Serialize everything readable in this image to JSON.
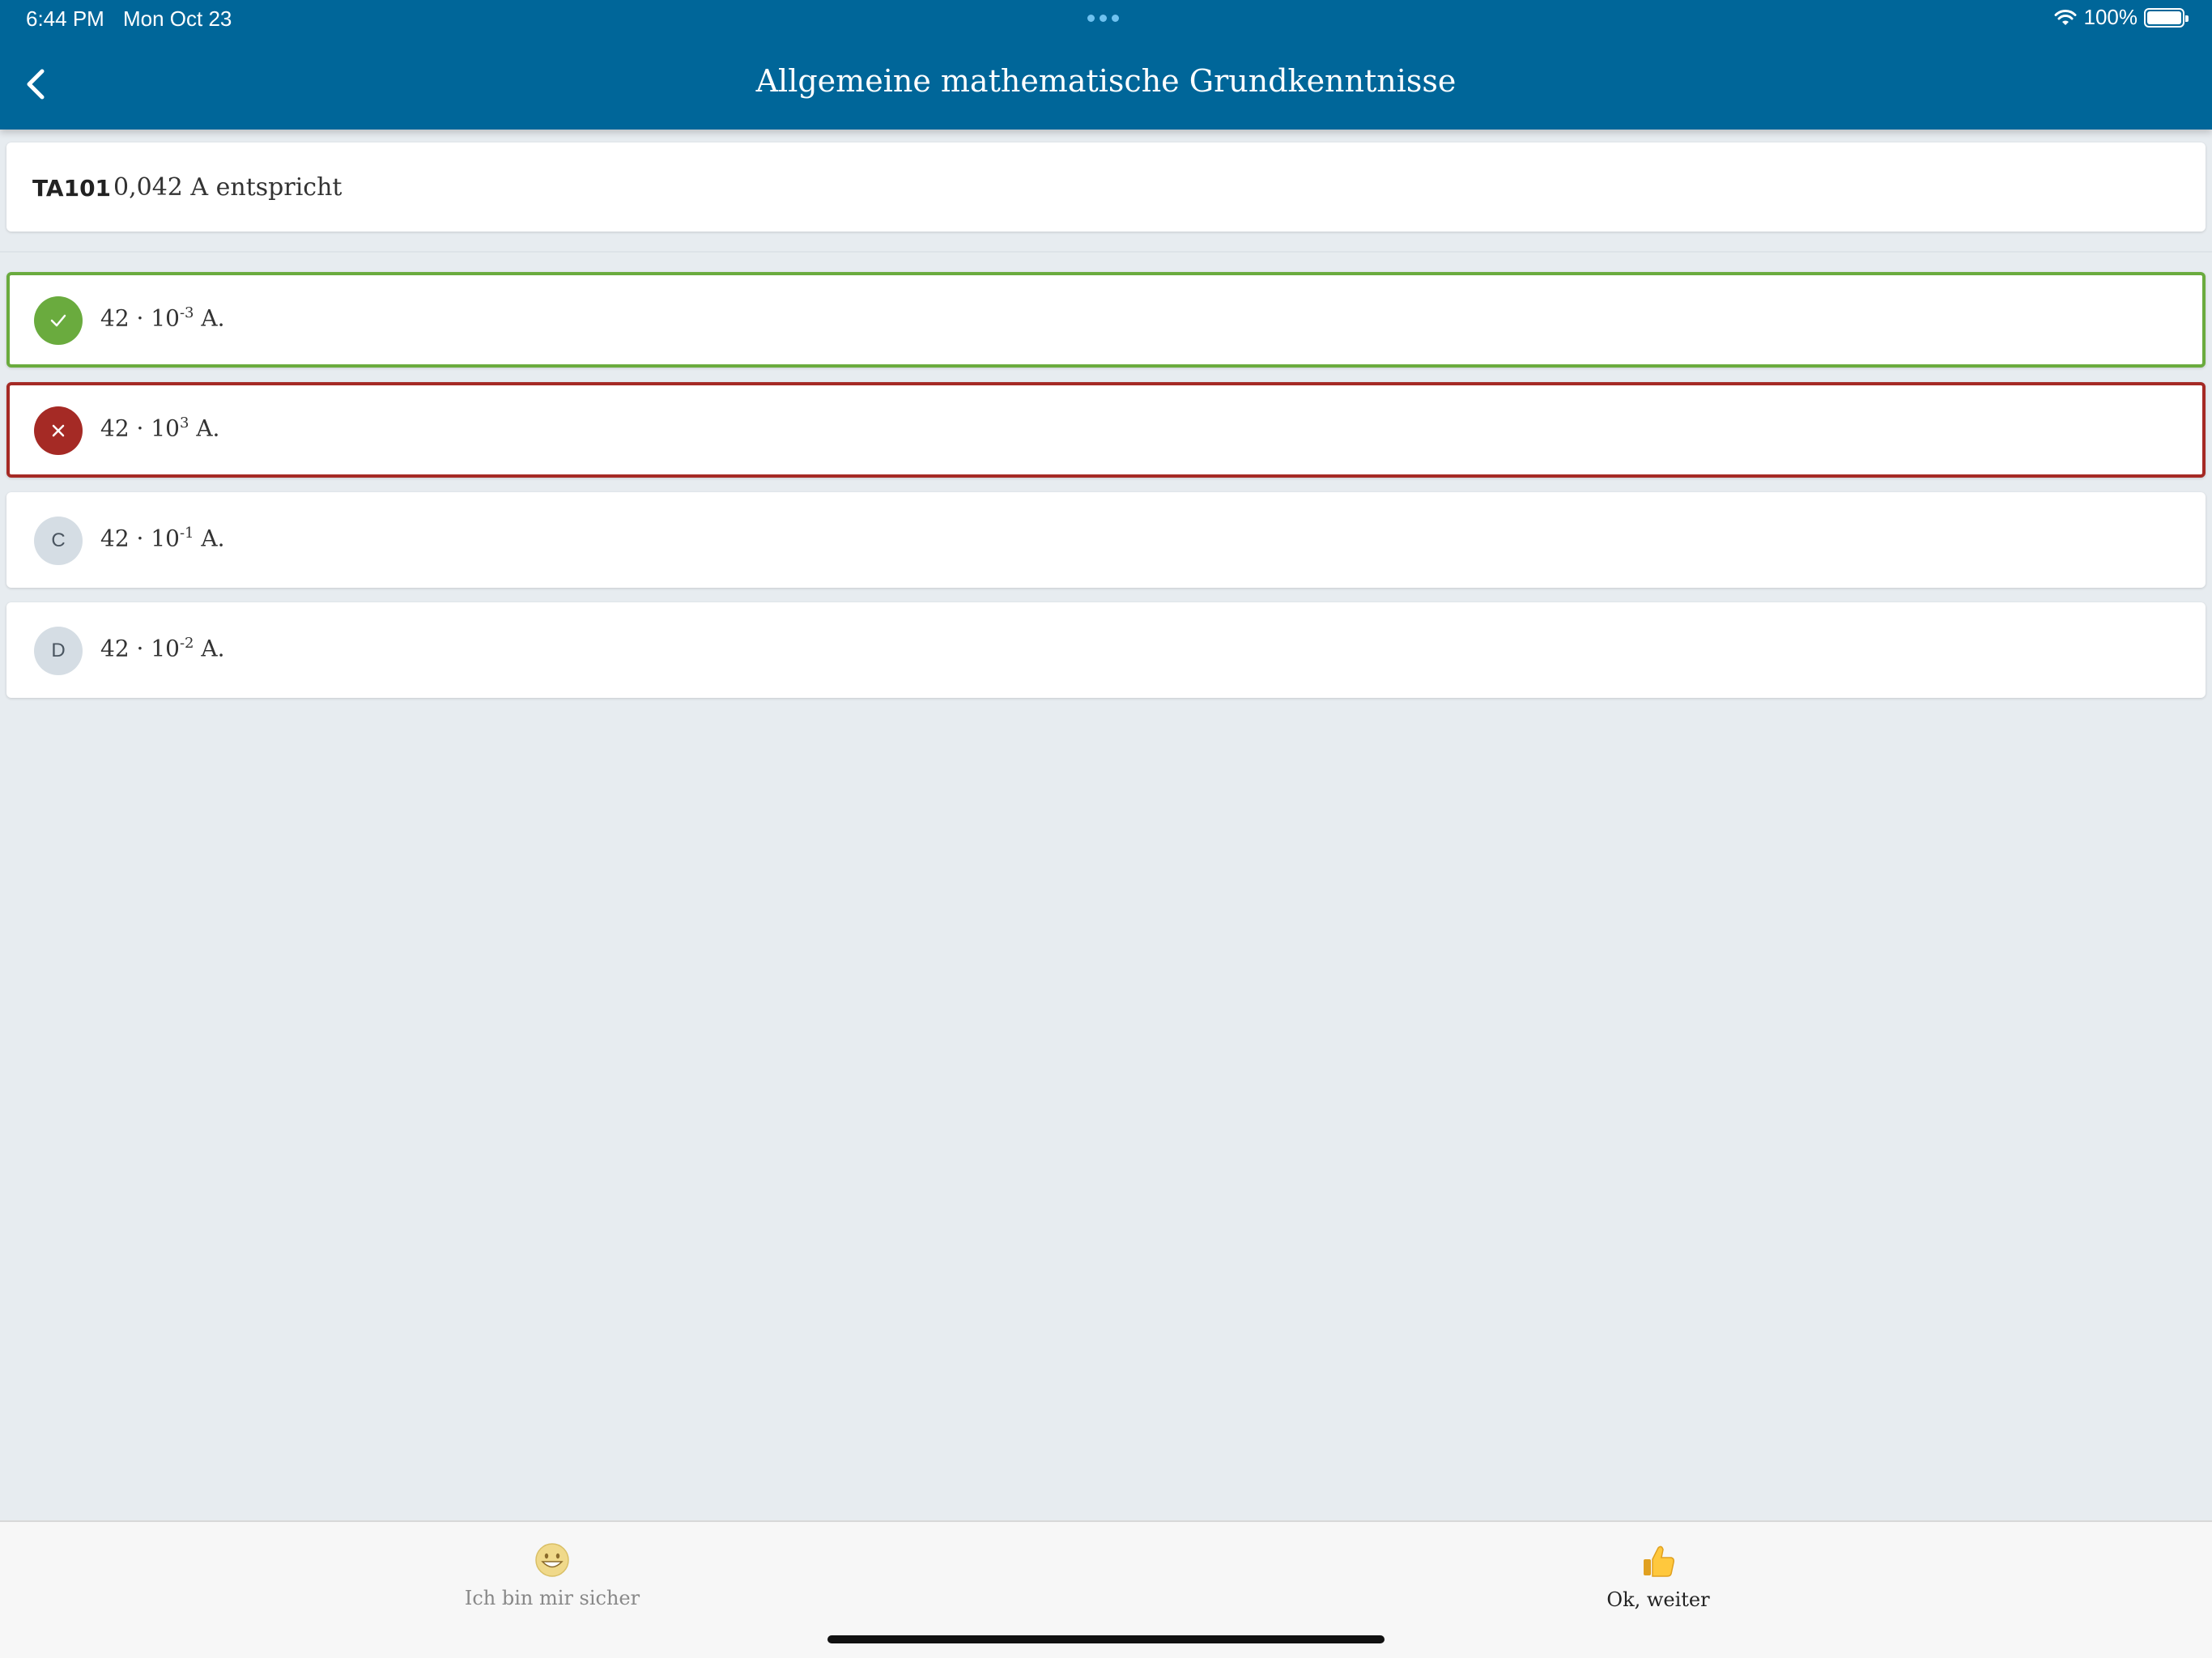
{
  "status_bar": {
    "time": "6:44 PM",
    "date": "Mon Oct 23",
    "battery": "100%"
  },
  "header": {
    "title": "Allgemeine mathematische Grundkenntnisse",
    "background_color": "#006699"
  },
  "question": {
    "code": "TA101",
    "text": "0,042 A entspricht"
  },
  "answers": [
    {
      "badge": "",
      "state": "correct",
      "base": "42 · 10",
      "exponent": "-3",
      "suffix": " A."
    },
    {
      "badge": "",
      "state": "wrong",
      "base": "42 · 10",
      "exponent": "3",
      "suffix": " A."
    },
    {
      "badge": "C",
      "state": "neutral",
      "base": "42 · 10",
      "exponent": "-1",
      "suffix": " A."
    },
    {
      "badge": "D",
      "state": "neutral",
      "base": "42 · 10",
      "exponent": "-2",
      "suffix": " A."
    }
  ],
  "bottom_bar": {
    "sure_label": "Ich bin mir sicher",
    "sure_icon": "grinning-face-icon",
    "next_label": "Ok, weiter",
    "next_icon": "thumbs-up-icon"
  },
  "colors": {
    "correct": "#6aab3e",
    "wrong": "#a52a25",
    "background": "#e7ecf0"
  }
}
